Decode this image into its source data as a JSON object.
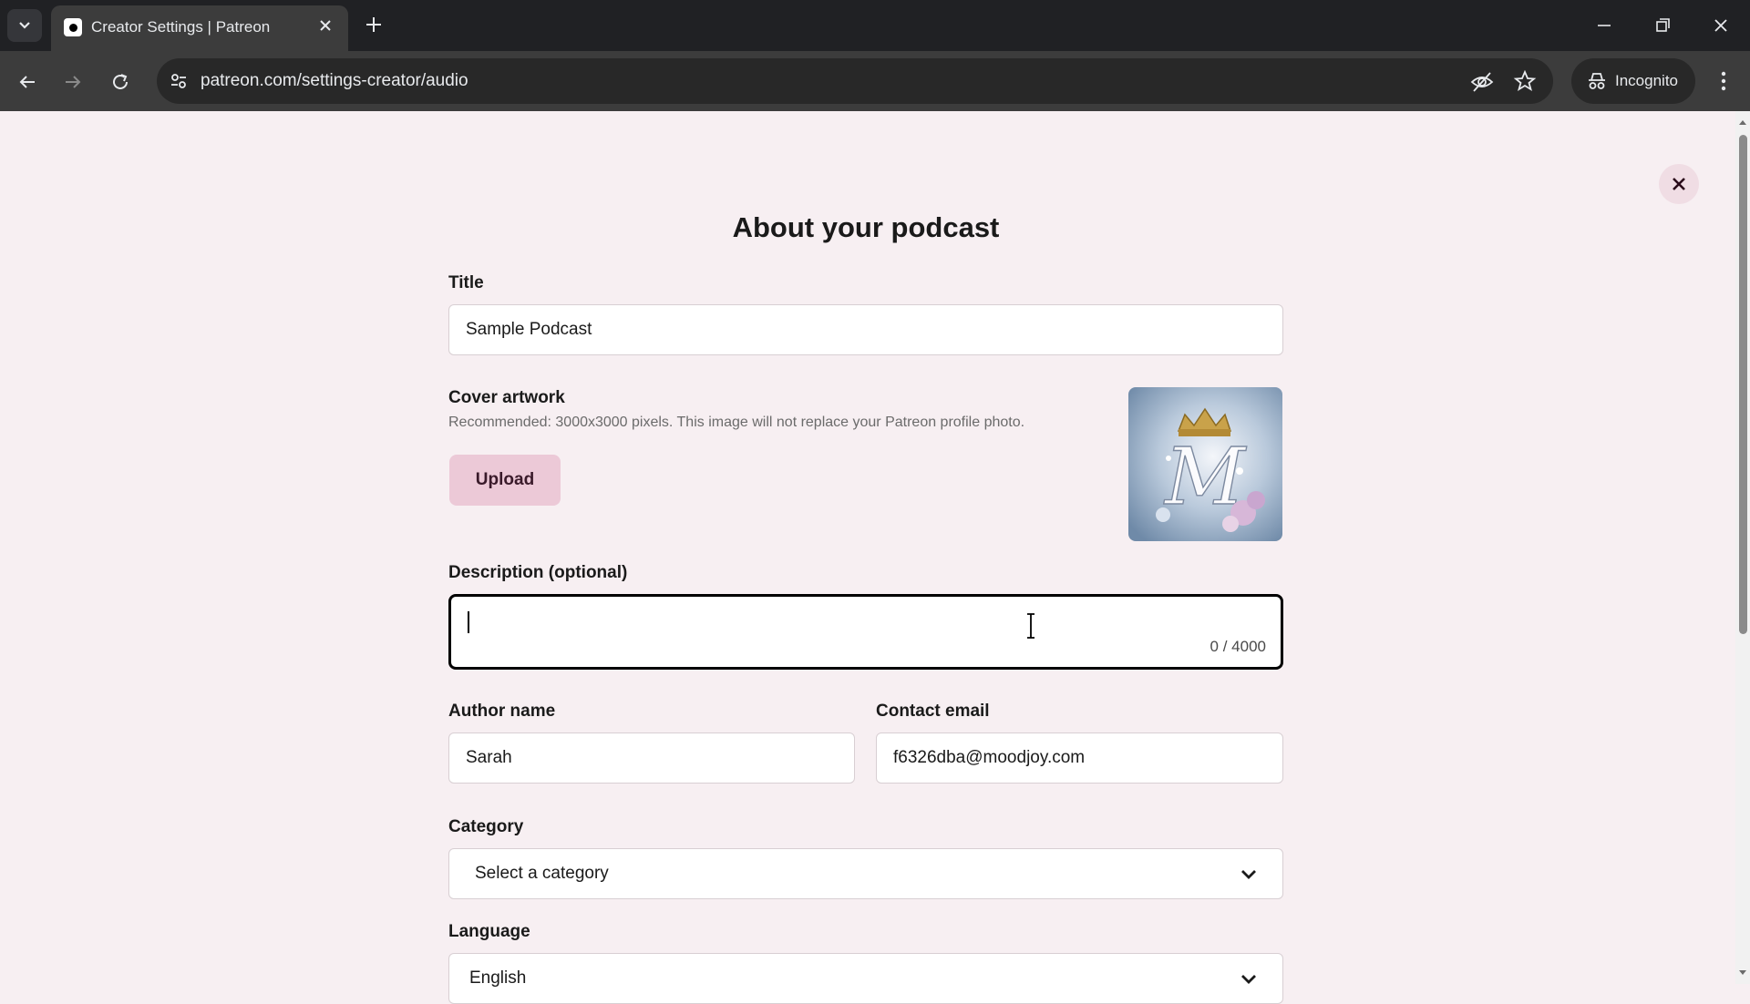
{
  "browser": {
    "tab_title": "Creator Settings | Patreon",
    "url": "patreon.com/settings-creator/audio",
    "incognito_label": "Incognito"
  },
  "form": {
    "heading": "About your podcast",
    "title_label": "Title",
    "title_value": "Sample Podcast",
    "cover_label": "Cover artwork",
    "cover_hint": "Recommended: 3000x3000 pixels. This image will not replace your Patreon profile photo.",
    "upload_label": "Upload",
    "description_label": "Description (optional)",
    "description_value": "",
    "description_counter": "0 / 4000",
    "author_label": "Author name",
    "author_value": "Sarah",
    "email_label": "Contact email",
    "email_value": "f6326dba@moodjoy.com",
    "category_label": "Category",
    "category_value": "Select a category",
    "language_label": "Language",
    "language_value": "English"
  },
  "icons": {
    "tab_list": "chevron-down-icon",
    "favicon": "patreon-logo-icon",
    "tab_close": "close-icon",
    "new_tab": "plus-icon",
    "back": "arrow-left-icon",
    "forward": "arrow-right-icon",
    "reload": "reload-icon",
    "site_info": "tune-icon",
    "eye_off": "eye-off-icon",
    "bookmark": "star-icon",
    "incognito": "incognito-icon",
    "menu": "more-vertical-icon",
    "modal_close": "close-icon"
  },
  "colors": {
    "page_bg": "#f7eff2",
    "upload_bg": "#ecc9d7",
    "chrome_dark": "#202124"
  }
}
